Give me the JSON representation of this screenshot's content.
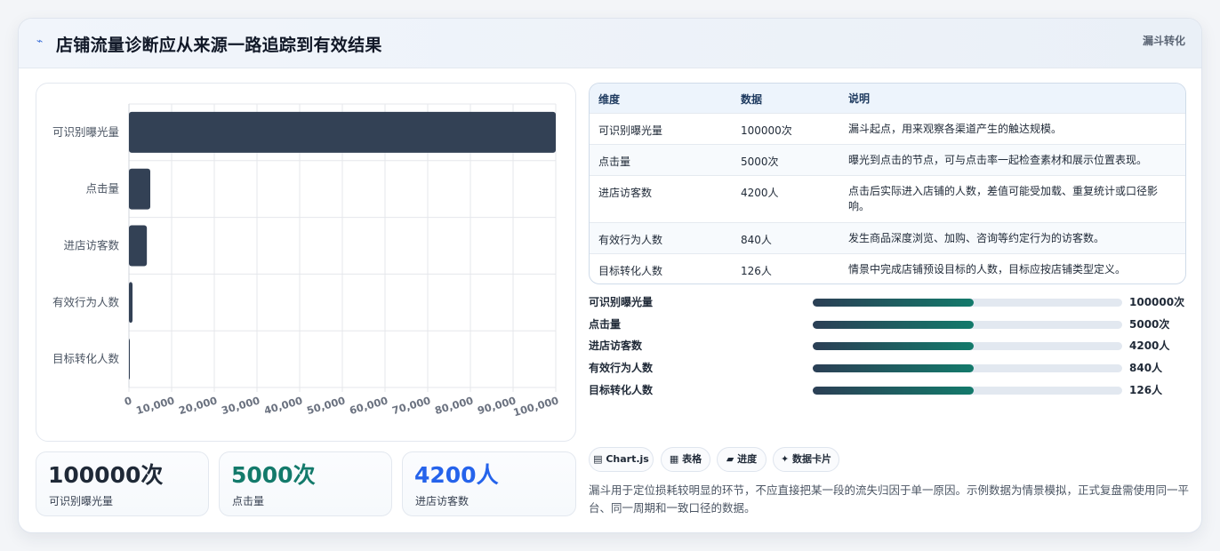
{
  "header": {
    "title": "店铺流量诊断应从来源一路追踪到有效结果",
    "tag": "漏斗转化",
    "icon": "lightning-icon"
  },
  "chart_data": {
    "type": "bar",
    "orientation": "horizontal",
    "categories": [
      "可识别曝光量",
      "点击量",
      "进店访客数",
      "有效行为人数",
      "目标转化人数"
    ],
    "values": [
      100000,
      5000,
      4200,
      840,
      126
    ],
    "xlim": [
      0,
      100000
    ],
    "xticks": [
      "0",
      "10,000",
      "20,000",
      "30,000",
      "40,000",
      "50,000",
      "60,000",
      "70,000",
      "80,000",
      "90,000",
      "100,000"
    ],
    "grid": true,
    "bar_color": "#334155"
  },
  "kpis": [
    {
      "value": "100000次",
      "label": "可识别曝光量",
      "color": "#1f2937"
    },
    {
      "value": "5000次",
      "label": "点击量",
      "color": "#137a6b"
    },
    {
      "value": "4200人",
      "label": "进店访客数",
      "color": "#2563eb"
    }
  ],
  "table": {
    "headers": [
      "维度",
      "数据",
      "说明"
    ],
    "rows": [
      [
        "可识别曝光量",
        "100000次",
        "漏斗起点，用来观察各渠道产生的触达规模。"
      ],
      [
        "点击量",
        "5000次",
        "曝光到点击的节点，可与点击率一起检查素材和展示位置表现。"
      ],
      [
        "进店访客数",
        "4200人",
        "点击后实际进入店铺的人数，差值可能受加载、重复统计或口径影响。"
      ],
      [
        "有效行为人数",
        "840人",
        "发生商品深度浏览、加购、咨询等约定行为的访客数。"
      ],
      [
        "目标转化人数",
        "126人",
        "情景中完成店铺预设目标的人数，目标应按店铺类型定义。"
      ]
    ]
  },
  "progress": [
    {
      "label": "可识别曝光量",
      "value": "100000次",
      "fraction": 0.52
    },
    {
      "label": "点击量",
      "value": "5000次",
      "fraction": 0.52
    },
    {
      "label": "进店访客数",
      "value": "4200人",
      "fraction": 0.52
    },
    {
      "label": "有效行为人数",
      "value": "840人",
      "fraction": 0.52
    },
    {
      "label": "目标转化人数",
      "value": "126人",
      "fraction": 0.52
    }
  ],
  "pills": [
    "▤ Chart.js",
    "▦ 表格",
    "▰ 进度",
    "✦ 数据卡片"
  ],
  "footnote": "漏斗用于定位损耗较明显的环节，不应直接把某一段的流失归因于单一原因。示例数据为情景模拟，正式复盘需使用同一平台、同一周期和一致口径的数据。"
}
